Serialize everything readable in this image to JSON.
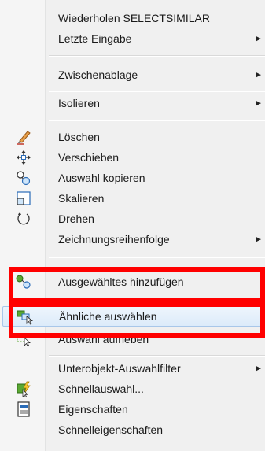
{
  "menu": {
    "items": [
      {
        "label": "Wiederholen SELECTSIMILAR",
        "icon": ""
      },
      {
        "label": "Letzte Eingabe",
        "icon": "",
        "submenu": true
      },
      {
        "label": "Zwischenablage",
        "icon": "",
        "submenu": true
      },
      {
        "label": "Isolieren",
        "icon": "",
        "submenu": true
      },
      {
        "label": "Löschen",
        "icon": "eraser-icon"
      },
      {
        "label": "Verschieben",
        "icon": "move-icon"
      },
      {
        "label": "Auswahl kopieren",
        "icon": "copy-selection-icon"
      },
      {
        "label": "Skalieren",
        "icon": "scale-icon"
      },
      {
        "label": "Drehen",
        "icon": "rotate-icon"
      },
      {
        "label": "Zeichnungsreihenfolge",
        "icon": "",
        "submenu": true
      },
      {
        "label": "Ausgewähltes hinzufügen",
        "icon": "add-selected-icon"
      },
      {
        "label": "Ähnliche auswählen",
        "icon": "select-similar-icon"
      },
      {
        "label": "Auswahl aufheben",
        "icon": "deselect-icon"
      },
      {
        "label": "Unterobjekt-Auswahlfilter",
        "icon": "",
        "submenu": true
      },
      {
        "label": "Schnellauswahl...",
        "icon": "quick-select-icon"
      },
      {
        "label": "Eigenschaften",
        "icon": "properties-icon"
      },
      {
        "label": "Schnelleigenschaften",
        "icon": ""
      }
    ],
    "submenu_arrow": "▶",
    "highlight_color": "#ff0000",
    "hover_item": "Ähnliche auswählen"
  }
}
